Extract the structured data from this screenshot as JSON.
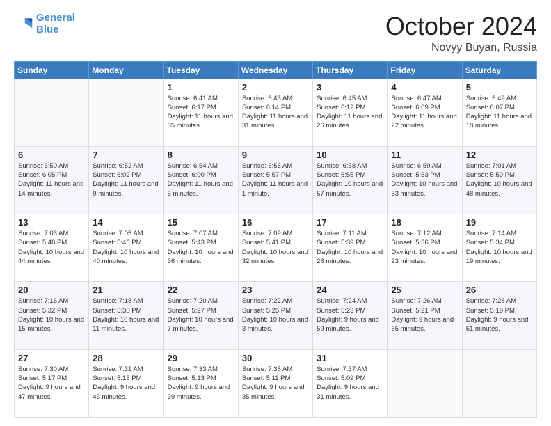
{
  "header": {
    "logo_line1": "General",
    "logo_line2": "Blue",
    "month": "October 2024",
    "location": "Novyy Buyan, Russia"
  },
  "weekdays": [
    "Sunday",
    "Monday",
    "Tuesday",
    "Wednesday",
    "Thursday",
    "Friday",
    "Saturday"
  ],
  "weeks": [
    [
      {
        "day": "",
        "text": ""
      },
      {
        "day": "",
        "text": ""
      },
      {
        "day": "1",
        "text": "Sunrise: 6:41 AM\nSunset: 6:17 PM\nDaylight: 11 hours and 35 minutes."
      },
      {
        "day": "2",
        "text": "Sunrise: 6:43 AM\nSunset: 6:14 PM\nDaylight: 11 hours and 31 minutes."
      },
      {
        "day": "3",
        "text": "Sunrise: 6:45 AM\nSunset: 6:12 PM\nDaylight: 11 hours and 26 minutes."
      },
      {
        "day": "4",
        "text": "Sunrise: 6:47 AM\nSunset: 6:09 PM\nDaylight: 11 hours and 22 minutes."
      },
      {
        "day": "5",
        "text": "Sunrise: 6:49 AM\nSunset: 6:07 PM\nDaylight: 11 hours and 18 minutes."
      }
    ],
    [
      {
        "day": "6",
        "text": "Sunrise: 6:50 AM\nSunset: 6:05 PM\nDaylight: 11 hours and 14 minutes."
      },
      {
        "day": "7",
        "text": "Sunrise: 6:52 AM\nSunset: 6:02 PM\nDaylight: 11 hours and 9 minutes."
      },
      {
        "day": "8",
        "text": "Sunrise: 6:54 AM\nSunset: 6:00 PM\nDaylight: 11 hours and 5 minutes."
      },
      {
        "day": "9",
        "text": "Sunrise: 6:56 AM\nSunset: 5:57 PM\nDaylight: 11 hours and 1 minute."
      },
      {
        "day": "10",
        "text": "Sunrise: 6:58 AM\nSunset: 5:55 PM\nDaylight: 10 hours and 57 minutes."
      },
      {
        "day": "11",
        "text": "Sunrise: 6:59 AM\nSunset: 5:53 PM\nDaylight: 10 hours and 53 minutes."
      },
      {
        "day": "12",
        "text": "Sunrise: 7:01 AM\nSunset: 5:50 PM\nDaylight: 10 hours and 48 minutes."
      }
    ],
    [
      {
        "day": "13",
        "text": "Sunrise: 7:03 AM\nSunset: 5:48 PM\nDaylight: 10 hours and 44 minutes."
      },
      {
        "day": "14",
        "text": "Sunrise: 7:05 AM\nSunset: 5:46 PM\nDaylight: 10 hours and 40 minutes."
      },
      {
        "day": "15",
        "text": "Sunrise: 7:07 AM\nSunset: 5:43 PM\nDaylight: 10 hours and 36 minutes."
      },
      {
        "day": "16",
        "text": "Sunrise: 7:09 AM\nSunset: 5:41 PM\nDaylight: 10 hours and 32 minutes."
      },
      {
        "day": "17",
        "text": "Sunrise: 7:11 AM\nSunset: 5:39 PM\nDaylight: 10 hours and 28 minutes."
      },
      {
        "day": "18",
        "text": "Sunrise: 7:12 AM\nSunset: 5:36 PM\nDaylight: 10 hours and 23 minutes."
      },
      {
        "day": "19",
        "text": "Sunrise: 7:14 AM\nSunset: 5:34 PM\nDaylight: 10 hours and 19 minutes."
      }
    ],
    [
      {
        "day": "20",
        "text": "Sunrise: 7:16 AM\nSunset: 5:32 PM\nDaylight: 10 hours and 15 minutes."
      },
      {
        "day": "21",
        "text": "Sunrise: 7:18 AM\nSunset: 5:30 PM\nDaylight: 10 hours and 11 minutes."
      },
      {
        "day": "22",
        "text": "Sunrise: 7:20 AM\nSunset: 5:27 PM\nDaylight: 10 hours and 7 minutes."
      },
      {
        "day": "23",
        "text": "Sunrise: 7:22 AM\nSunset: 5:25 PM\nDaylight: 10 hours and 3 minutes."
      },
      {
        "day": "24",
        "text": "Sunrise: 7:24 AM\nSunset: 5:23 PM\nDaylight: 9 hours and 59 minutes."
      },
      {
        "day": "25",
        "text": "Sunrise: 7:26 AM\nSunset: 5:21 PM\nDaylight: 9 hours and 55 minutes."
      },
      {
        "day": "26",
        "text": "Sunrise: 7:28 AM\nSunset: 5:19 PM\nDaylight: 9 hours and 51 minutes."
      }
    ],
    [
      {
        "day": "27",
        "text": "Sunrise: 7:30 AM\nSunset: 5:17 PM\nDaylight: 9 hours and 47 minutes."
      },
      {
        "day": "28",
        "text": "Sunrise: 7:31 AM\nSunset: 5:15 PM\nDaylight: 9 hours and 43 minutes."
      },
      {
        "day": "29",
        "text": "Sunrise: 7:33 AM\nSunset: 5:13 PM\nDaylight: 9 hours and 39 minutes."
      },
      {
        "day": "30",
        "text": "Sunrise: 7:35 AM\nSunset: 5:11 PM\nDaylight: 9 hours and 35 minutes."
      },
      {
        "day": "31",
        "text": "Sunrise: 7:37 AM\nSunset: 5:09 PM\nDaylight: 9 hours and 31 minutes."
      },
      {
        "day": "",
        "text": ""
      },
      {
        "day": "",
        "text": ""
      }
    ]
  ]
}
